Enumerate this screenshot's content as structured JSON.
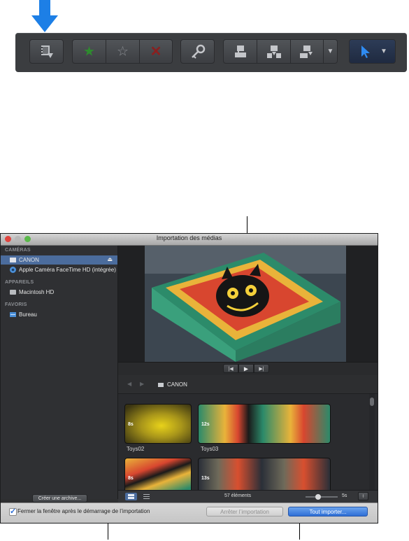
{
  "toolbar": {
    "buttons": [
      "import-media",
      "favorite",
      "unrate",
      "reject",
      "keyword",
      "connect",
      "insert",
      "append",
      "edit-menu",
      "select-tool"
    ]
  },
  "window": {
    "title": "Importation des médias",
    "sidebar": {
      "sections": [
        {
          "heading": "CAMÉRAS",
          "items": [
            {
              "label": "CANON",
              "selected": true
            },
            {
              "label": "Apple Caméra FaceTime HD (intégrée)",
              "selected": false
            }
          ]
        },
        {
          "heading": "APPAREILS",
          "items": [
            {
              "label": "Macintosh HD",
              "selected": false
            }
          ]
        },
        {
          "heading": "FAVORIS",
          "items": [
            {
              "label": "Bureau",
              "selected": false
            }
          ]
        }
      ],
      "archive_button": "Créer une archive..."
    },
    "path": {
      "label": "CANON"
    },
    "clips": [
      {
        "name": "Toys02",
        "duration": "8s"
      },
      {
        "name": "Toys03",
        "duration": "12s"
      },
      {
        "name": "",
        "duration": "8s"
      },
      {
        "name": "",
        "duration": "13s"
      }
    ],
    "status": {
      "count": "57 éléments",
      "clip_length": "5s"
    },
    "footer": {
      "checkbox_label": "Fermer la fenêtre après le démarrage de l’importation",
      "checkbox_checked": true,
      "stop_button": "Arrêter l’importation",
      "import_button": "Tout importer..."
    }
  },
  "colors": {
    "accent": "#2f6fd6",
    "star_green": "#2e8b2e",
    "reject_red": "#8a1f1f",
    "arrow_blue": "#1d7fe6"
  }
}
